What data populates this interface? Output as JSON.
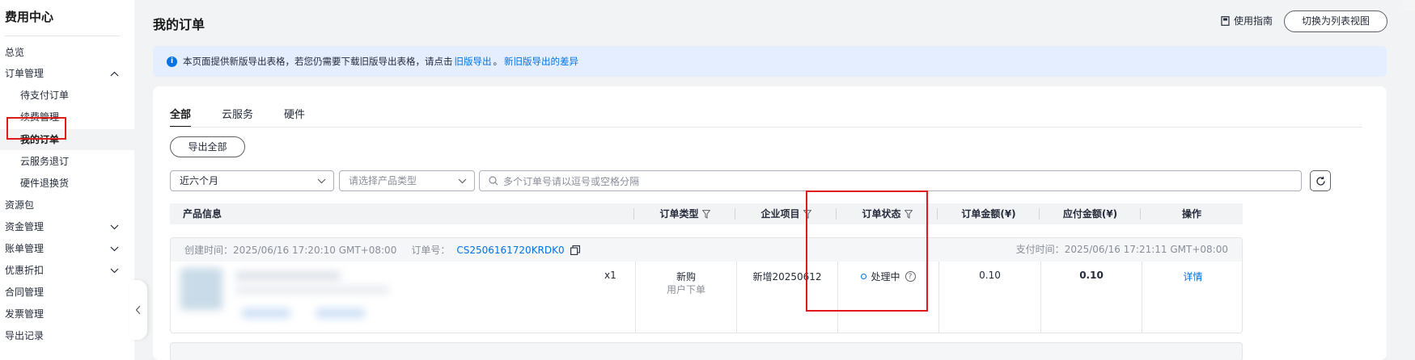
{
  "sidebar": {
    "title": "费用中心",
    "items": [
      {
        "label": "总览",
        "level": 0,
        "chevron": ""
      },
      {
        "label": "订单管理",
        "level": 0,
        "chevron": "up"
      },
      {
        "label": "待支付订单",
        "level": 1,
        "chevron": ""
      },
      {
        "label": "续费管理",
        "level": 1,
        "chevron": ""
      },
      {
        "label": "我的订单",
        "level": 1,
        "chevron": "",
        "active": true
      },
      {
        "label": "云服务退订",
        "level": 1,
        "chevron": ""
      },
      {
        "label": "硬件退换货",
        "level": 1,
        "chevron": ""
      },
      {
        "label": "资源包",
        "level": 0,
        "chevron": ""
      },
      {
        "label": "资金管理",
        "level": 0,
        "chevron": "down"
      },
      {
        "label": "账单管理",
        "level": 0,
        "chevron": "down"
      },
      {
        "label": "优惠折扣",
        "level": 0,
        "chevron": "down"
      },
      {
        "label": "合同管理",
        "level": 0,
        "chevron": ""
      },
      {
        "label": "发票管理",
        "level": 0,
        "chevron": ""
      },
      {
        "label": "导出记录",
        "level": 0,
        "chevron": ""
      }
    ]
  },
  "header": {
    "title": "我的订单",
    "guide_label": "使用指南",
    "switch_label": "切换为列表视图"
  },
  "notice": {
    "text_before": "本页面提供新版导出表格，若您仍需要下载旧版导出表格，请点击",
    "link_old": "旧版导出",
    "separator": "。",
    "link_diff": "新旧版导出的差异"
  },
  "tabs": [
    "全部",
    "云服务",
    "硬件"
  ],
  "toolbar": {
    "export_all": "导出全部",
    "period": "近六个月",
    "product_type_placeholder": "请选择产品类型",
    "search_placeholder": "多个订单号请以逗号或空格分隔"
  },
  "table": {
    "headers": {
      "product": "产品信息",
      "order_type": "订单类型",
      "enterprise_project": "企业项目",
      "status": "订单状态",
      "order_amount": "订单金额(¥)",
      "payable_amount": "应付金额(¥)",
      "actions": "操作"
    },
    "order": {
      "created_label": "创建时间：",
      "created_time": "2025/06/16 17:20:10 GMT+08:00",
      "order_no_label": "订单号：",
      "order_no": "CS2506161720KRDK0",
      "pay_time_label": "支付时间：",
      "pay_time": "2025/06/16 17:21:11 GMT+08:00",
      "quantity": "x1",
      "order_type": "新购",
      "order_sub_type": "用户下单",
      "enterprise_project": "新增20250612",
      "status": "处理中",
      "order_amount": "0.10",
      "payable_amount": "0.10",
      "action": "详情"
    }
  },
  "colors": {
    "accent": "#0073e6",
    "highlight": "#e0191a",
    "notice_bg": "#e4eefe"
  }
}
